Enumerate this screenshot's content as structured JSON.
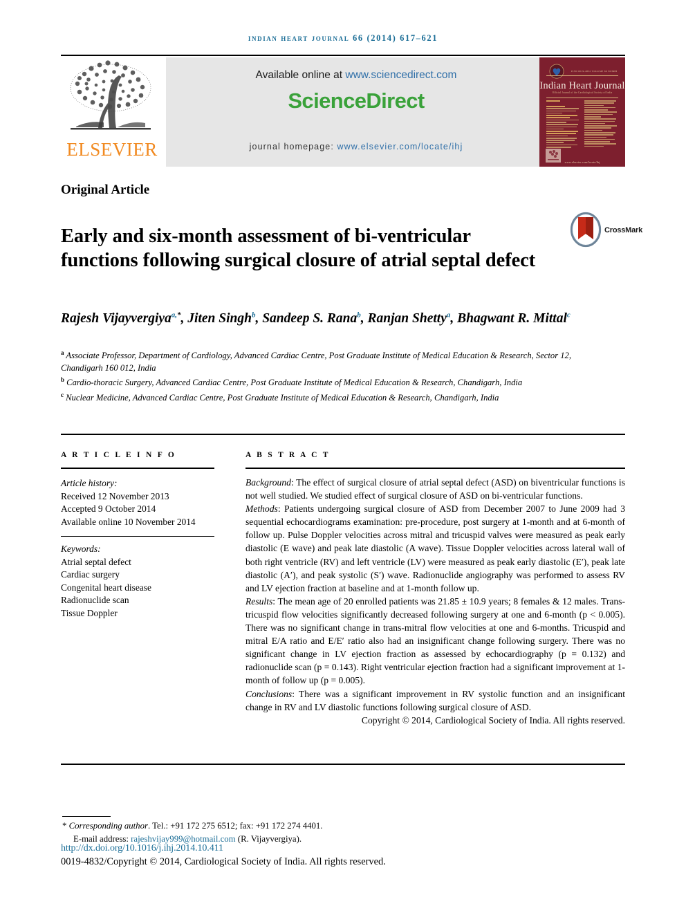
{
  "running_head": "Indian Heart Journal 66 (2014) 617–621",
  "masthead": {
    "publisher_name": "ELSEVIER",
    "available_prefix": "Available online at ",
    "available_url": "www.sciencedirect.com",
    "sciencedirect_logo": "ScienceDirect",
    "homepage_prefix": "journal homepage: ",
    "homepage_url": "www.elsevier.com/locate/ihj",
    "cover": {
      "title": "Indian Heart Journal",
      "top_line": "ISSN 0019-4832  VOLUME 66  NUMBER 6",
      "subtitle": "Official Journal of the Cardiological Society of India",
      "footer": "www.elsevier.com/locate/ihj"
    }
  },
  "article": {
    "type": "Original Article",
    "title": "Early and six-month assessment of bi-ventricular functions following surgical closure of atrial septal defect",
    "crossmark_label": "CrossMark"
  },
  "authors": {
    "line1": [
      {
        "name": "Rajesh Vijayvergiya",
        "sup": "a,",
        "star": "*"
      },
      {
        "name": "Jiten Singh",
        "sup": "b"
      },
      {
        "name": "Sandeep S. Rana",
        "sup": "b"
      },
      {
        "name": "Ranjan Shetty",
        "sup": "a"
      }
    ],
    "line2": [
      {
        "name": "Bhagwant R. Mittal",
        "sup": "c"
      }
    ]
  },
  "affiliations": [
    {
      "mark": "a",
      "text": "Associate Professor, Department of Cardiology, Advanced Cardiac Centre, Post Graduate Institute of Medical Education & Research, Sector 12, Chandigarh 160 012, India"
    },
    {
      "mark": "b",
      "text": "Cardio-thoracic Surgery, Advanced Cardiac Centre, Post Graduate Institute of Medical Education & Research, Chandigarh, India"
    },
    {
      "mark": "c",
      "text": "Nuclear Medicine, Advanced Cardiac Centre, Post Graduate Institute of Medical Education & Research, Chandigarh, India"
    }
  ],
  "article_info": {
    "heading": "A R T I C L E   I N F O",
    "history_label": "Article history:",
    "history": [
      "Received 12 November 2013",
      "Accepted 9 October 2014",
      "Available online 10 November 2014"
    ],
    "keywords_label": "Keywords:",
    "keywords": [
      "Atrial septal defect",
      "Cardiac surgery",
      "Congenital heart disease",
      "Radionuclide scan",
      "Tissue Doppler"
    ]
  },
  "abstract": {
    "heading": "A B S T R A C T",
    "sections": [
      {
        "label": "Background",
        "text": ": The effect of surgical closure of atrial septal defect (ASD) on biventricular functions is not well studied. We studied effect of surgical closure of ASD on bi-ventricular functions."
      },
      {
        "label": "Methods",
        "text": ": Patients undergoing surgical closure of ASD from December 2007 to June 2009 had 3 sequential echocardiograms examination: pre-procedure, post surgery at 1-month and at 6-month of follow up. Pulse Doppler velocities across mitral and tricuspid valves were measured as peak early diastolic (E wave) and peak late diastolic (A wave). Tissue Doppler velocities across lateral wall of both right ventricle (RV) and left ventricle (LV) were measured as peak early diastolic (E′), peak late diastolic (A′), and peak systolic (S′) wave. Radionuclide angiography was performed to assess RV and LV ejection fraction at baseline and at 1-month follow up."
      },
      {
        "label": "Results",
        "text": ": The mean age of 20 enrolled patients was 21.85 ± 10.9 years; 8 females & 12 males. Trans-tricuspid flow velocities significantly decreased following surgery at one and 6-month (p < 0.005). There was no significant change in trans-mitral flow velocities at one and 6-months. Tricuspid and mitral E/A ratio and E/E′ ratio also had an insignificant change following surgery. There was no significant change in LV ejection fraction as assessed by echocardiography (p = 0.132) and radionuclide scan (p = 0.143). Right ventricular ejection fraction had a significant improvement at 1-month of follow up (p = 0.005)."
      },
      {
        "label": "Conclusions",
        "text": ": There was a significant improvement in RV systolic function and an insignificant change in RV and LV diastolic functions following surgical closure of ASD."
      }
    ],
    "copyright": "Copyright © 2014, Cardiological Society of India. All rights reserved."
  },
  "footer": {
    "corresponding_label": "Corresponding author",
    "corresponding_contact": ". Tel.: +91 172 275 6512; fax: +91 172 274 4401.",
    "email_label": "E-mail address: ",
    "email": "rajeshvijay999@hotmail.com",
    "email_owner": " (R. Vijayvergiya).",
    "doi": "http://dx.doi.org/10.1016/j.ihj.2014.10.411",
    "issn_copyright": "0019-4832/Copyright © 2014, Cardiological Society of India. All rights reserved."
  },
  "colors": {
    "link": "#1a6d96",
    "sciencedirect_green": "#3aa23a",
    "elsevier_orange": "#f18a21",
    "cover_maroon": "#7d1f2e"
  }
}
